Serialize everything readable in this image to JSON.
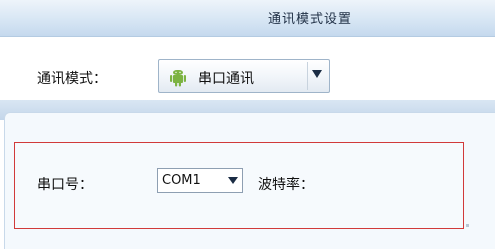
{
  "window": {
    "title": "通讯模式设置"
  },
  "mode": {
    "label": "通讯模式：",
    "selected": "串口通讯",
    "icon": "android-icon"
  },
  "serial": {
    "port_label": "串口号：",
    "port_value": "COM1",
    "baud_label": "波特率："
  },
  "colors": {
    "highlight_border": "#d13a3a",
    "titlebar": "#d7e6f4",
    "android_green": "#7cb342"
  }
}
